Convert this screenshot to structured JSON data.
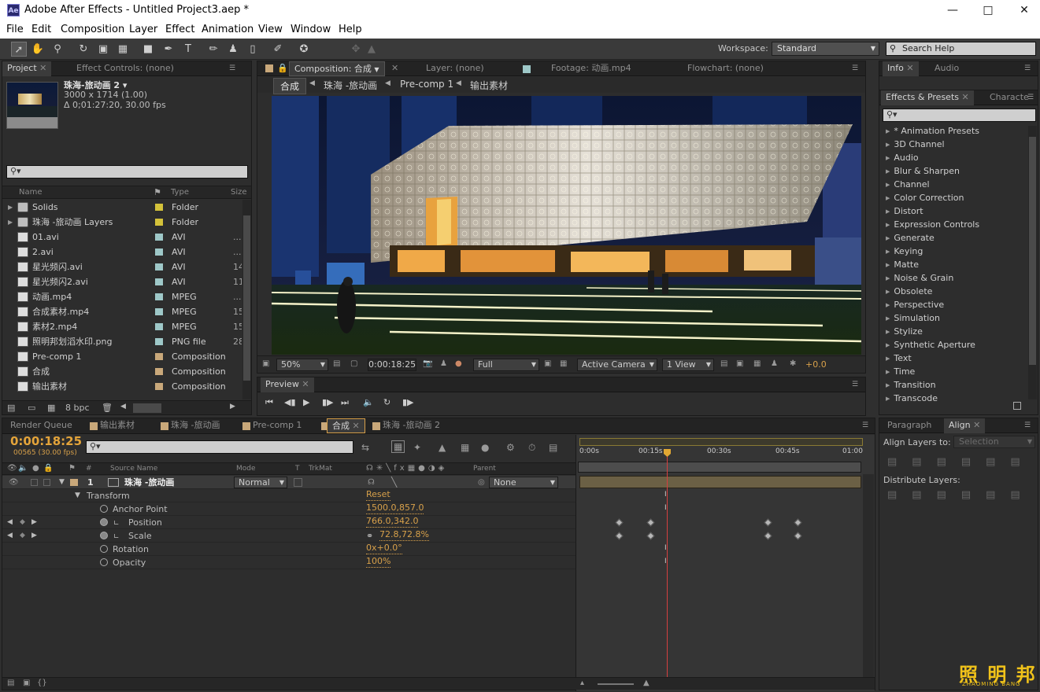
{
  "window": {
    "title": "Adobe After Effects - Untitled Project3.aep *",
    "logo": "Ae"
  },
  "menu": [
    "File",
    "Edit",
    "Composition",
    "Layer",
    "Effect",
    "Animation",
    "View",
    "Window",
    "Help"
  ],
  "toolbar": {
    "workspace_label": "Workspace:",
    "workspace_value": "Standard",
    "search_placeholder": "Search Help"
  },
  "project": {
    "tabs": [
      "Project",
      "Effect Controls: (none)"
    ],
    "selected": {
      "name": "珠海-旅动画 2 ▾",
      "dims": "3000 x 1714 (1.00)",
      "duration": "Δ 0;01:27:20, 30.00 fps"
    },
    "columns": {
      "name": "Name",
      "type": "Type",
      "size": "Size"
    },
    "items": [
      {
        "name": "Solids",
        "type": "Folder",
        "size": "",
        "label": "#d4c23a",
        "icon": "folder-icon"
      },
      {
        "name": "珠海 -旅动画  Layers",
        "type": "Folder",
        "size": "",
        "label": "#d4c23a",
        "icon": "folder-icon"
      },
      {
        "name": "01.avi",
        "type": "AVI",
        "size": "...",
        "label": "#9ec8c8",
        "icon": "footage-icon"
      },
      {
        "name": "2.avi",
        "type": "AVI",
        "size": "...",
        "label": "#9ec8c8",
        "icon": "footage-icon"
      },
      {
        "name": "星光频闪.avi",
        "type": "AVI",
        "size": "14",
        "label": "#9ec8c8",
        "icon": "footage-icon"
      },
      {
        "name": "星光频闪2.avi",
        "type": "AVI",
        "size": "11",
        "label": "#9ec8c8",
        "icon": "footage-icon"
      },
      {
        "name": "动画.mp4",
        "type": "MPEG",
        "size": "...",
        "label": "#9ec8c8",
        "icon": "footage-icon"
      },
      {
        "name": "合成素材.mp4",
        "type": "MPEG",
        "size": "15",
        "label": "#9ec8c8",
        "icon": "footage-icon"
      },
      {
        "name": "素材2.mp4",
        "type": "MPEG",
        "size": "15",
        "label": "#9ec8c8",
        "icon": "footage-icon"
      },
      {
        "name": "照明邦划滔水印.png",
        "type": "PNG file",
        "size": "28",
        "label": "#9ec8c8",
        "icon": "image-icon"
      },
      {
        "name": "Pre-comp 1",
        "type": "Composition",
        "size": "",
        "label": "#c9a87a",
        "icon": "composition-icon"
      },
      {
        "name": "合成",
        "type": "Composition",
        "size": "",
        "label": "#c9a87a",
        "icon": "composition-icon"
      },
      {
        "name": "输出素材",
        "type": "Composition",
        "size": "",
        "label": "#c9a87a",
        "icon": "composition-icon"
      }
    ],
    "bpc": "8 bpc"
  },
  "comp": {
    "tabs": [
      "Composition: 合成",
      "Layer: (none)",
      "Footage: 动画.mp4",
      "Flowchart: (none)"
    ],
    "breadcrumbs": [
      "合成",
      "珠海 -旅动画",
      "Pre-comp 1",
      "输出素材"
    ],
    "zoom": "50%",
    "timecode": "0:00:18:25",
    "resolution": "Full",
    "camera": "Active Camera",
    "view": "1 View",
    "exposure": "+0.0"
  },
  "preview": {
    "tab": "Preview"
  },
  "info": {
    "tabs": [
      "Info",
      "Audio"
    ]
  },
  "effects": {
    "tabs": [
      "Effects & Presets",
      "Characte"
    ],
    "items": [
      "* Animation Presets",
      "3D Channel",
      "Audio",
      "Blur & Sharpen",
      "Channel",
      "Color Correction",
      "Distort",
      "Expression Controls",
      "Generate",
      "Keying",
      "Matte",
      "Noise & Grain",
      "Obsolete",
      "Perspective",
      "Simulation",
      "Stylize",
      "Synthetic Aperture",
      "Text",
      "Time",
      "Transition",
      "Transcode"
    ]
  },
  "align": {
    "tabs": [
      "Paragraph",
      "Align"
    ],
    "align_to_label": "Align Layers to:",
    "align_to_value": "Selection",
    "distribute_label": "Distribute Layers:"
  },
  "timeline": {
    "tabs": [
      "Render Queue",
      "输出素材",
      "珠海 -旅动画",
      "Pre-comp 1",
      "合成",
      "珠海 -旅动画 2"
    ],
    "timecode": "0:00:18:25",
    "frames": "00565 (30.00 fps)",
    "columns": {
      "source": "Source Name",
      "mode": "Mode",
      "t": "T",
      "trkmat": "TrkMat",
      "parent": "Parent",
      "num": "#"
    },
    "layer": {
      "index": "1",
      "name": "珠海 -旅动画",
      "mode": "Normal",
      "parent": "None"
    },
    "transform": {
      "label": "Transform",
      "reset": "Reset"
    },
    "properties": [
      {
        "name": "Anchor Point",
        "value": "1500.0,857.0"
      },
      {
        "name": "Position",
        "value": "766.0,342.0"
      },
      {
        "name": "Scale",
        "value": "72.8,72.8%"
      },
      {
        "name": "Rotation",
        "value": "0x+0.0°"
      },
      {
        "name": "Opacity",
        "value": "100%"
      }
    ],
    "ruler": [
      "0:00s",
      "00:15s",
      "00:30s",
      "00:45s",
      "01:00"
    ]
  },
  "watermark": {
    "text": "照 明 邦",
    "sub": "ZHAOMING BANG"
  }
}
